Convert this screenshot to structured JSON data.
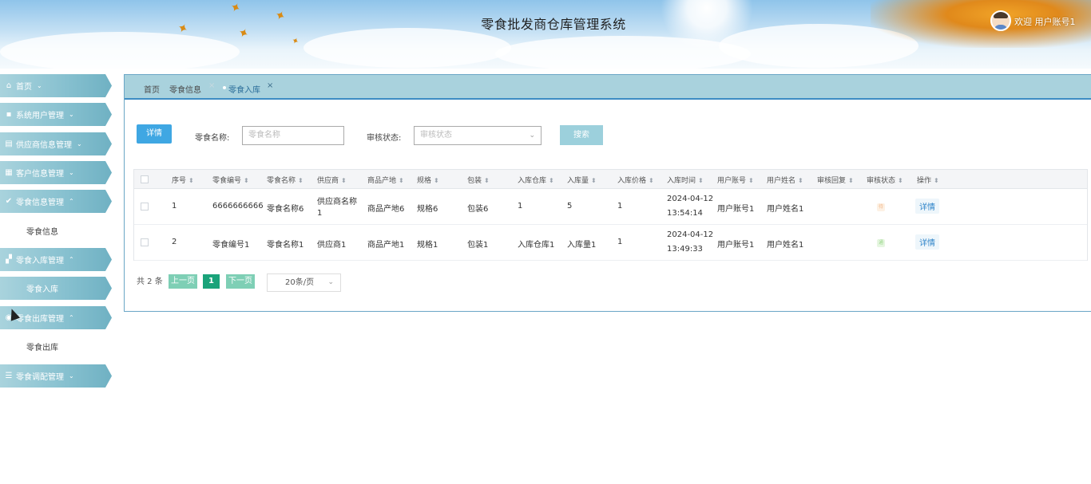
{
  "header": {
    "title": "零食批发商仓库管理系统",
    "welcome": "欢迎 用户账号1"
  },
  "sidebar": {
    "items": [
      {
        "label": "首页",
        "icon": "home-icon",
        "arrow": "⌄"
      },
      {
        "label": "系统用户管理",
        "icon": "user-icon",
        "arrow": "⌄"
      },
      {
        "label": "供应商信息管理",
        "icon": "folder-icon",
        "arrow": "⌄"
      },
      {
        "label": "客户信息管理",
        "icon": "grid-icon",
        "arrow": "⌄"
      },
      {
        "label": "零食信息管理",
        "icon": "check-circle-icon",
        "arrow": "⌃",
        "sub": [
          {
            "label": "零食信息"
          }
        ]
      },
      {
        "label": "零食入库管理",
        "icon": "apps-icon",
        "arrow": "⌃",
        "sub": [
          {
            "label": "零食入库",
            "active": true
          }
        ]
      },
      {
        "label": "零食出库管理",
        "icon": "settings-icon",
        "arrow": "⌃",
        "sub": [
          {
            "label": "零食出库"
          }
        ]
      },
      {
        "label": "零食调配管理",
        "icon": "list-icon",
        "arrow": "⌄"
      }
    ]
  },
  "tabs": [
    {
      "label": "首页"
    },
    {
      "label": "零食信息",
      "close": "×"
    },
    {
      "label": "零食入库",
      "close": "×",
      "current": true
    }
  ],
  "toolbar": {
    "detail_button": "详情",
    "name_label": "零食名称:",
    "name_placeholder": "零食名称",
    "status_label": "审核状态:",
    "status_placeholder": "审核状态",
    "search_button": "搜索"
  },
  "table": {
    "columns": [
      "序号",
      "零食编号",
      "零食名称",
      "供应商",
      "商品产地",
      "规格",
      "包装",
      "入库仓库",
      "入库量",
      "入库价格",
      "入库时间",
      "用户账号",
      "用户姓名",
      "审核回复",
      "审核状态",
      "操作"
    ],
    "rows": [
      {
        "index": "1",
        "code": "6666666666",
        "name": "零食名称6",
        "supplier_line1": "供应商名称",
        "supplier_line2": "1",
        "origin": "商品产地6",
        "spec": "规格6",
        "pack": "包装6",
        "warehouse": "1",
        "qty": "5",
        "price": "1",
        "date": "2024-04-12",
        "time": "13:54:14",
        "account": "用户账号1",
        "username": "用户姓名1",
        "reply": "",
        "status_color": "#fdf1e4",
        "status_text_color": "#f3b98c",
        "status_text": "待",
        "action": "详情"
      },
      {
        "index": "2",
        "code": "零食编号1",
        "name": "零食名称1",
        "supplier_line1": "供应商1",
        "supplier_line2": "",
        "origin": "商品产地1",
        "spec": "规格1",
        "pack": "包装1",
        "warehouse": "入库仓库1",
        "qty": "入库量1",
        "price": "1",
        "date": "2024-04-12",
        "time": "13:49:33",
        "account": "用户账号1",
        "username": "用户姓名1",
        "reply": "",
        "status_color": "#e6f6e1",
        "status_text_color": "#9ad68a",
        "status_text": "通",
        "action": "详情"
      }
    ]
  },
  "pager": {
    "total": "共 2 条",
    "prev": "上一页",
    "current": "1",
    "next": "下一页",
    "page_size": "20条/页"
  },
  "colors": {
    "nav_gradient": "#86c0cf",
    "accent_blue": "#3fa7e3",
    "pager_green": "#7ecfb5",
    "pager_active": "#1aa37a"
  }
}
